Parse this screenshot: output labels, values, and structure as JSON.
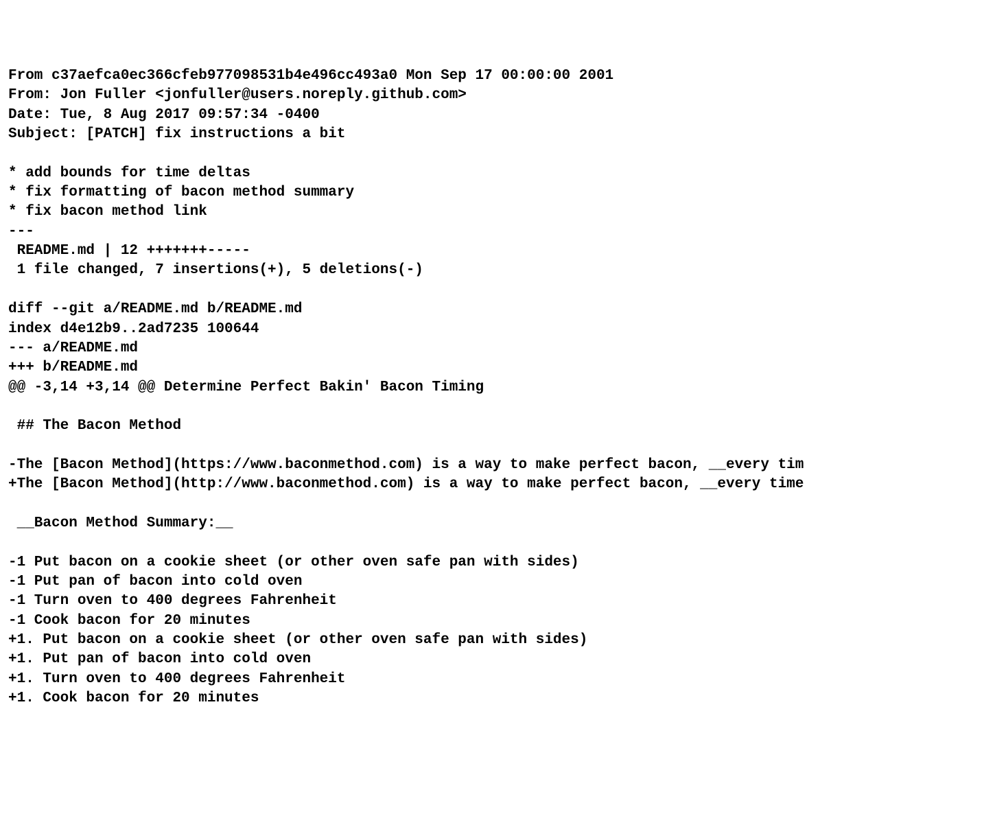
{
  "lines": [
    "From c37aefca0ec366cfeb977098531b4e496cc493a0 Mon Sep 17 00:00:00 2001",
    "From: Jon Fuller <jonfuller@users.noreply.github.com>",
    "Date: Tue, 8 Aug 2017 09:57:34 -0400",
    "Subject: [PATCH] fix instructions a bit",
    "",
    "* add bounds for time deltas",
    "* fix formatting of bacon method summary",
    "* fix bacon method link",
    "---",
    " README.md | 12 +++++++-----",
    " 1 file changed, 7 insertions(+), 5 deletions(-)",
    "",
    "diff --git a/README.md b/README.md",
    "index d4e12b9..2ad7235 100644",
    "--- a/README.md",
    "+++ b/README.md",
    "@@ -3,14 +3,14 @@ Determine Perfect Bakin' Bacon Timing",
    " ",
    " ## The Bacon Method",
    " ",
    "-The [Bacon Method](https://www.baconmethod.com) is a way to make perfect bacon, __every tim",
    "+The [Bacon Method](http://www.baconmethod.com) is a way to make perfect bacon, __every time",
    " ",
    " __Bacon Method Summary:__",
    " ",
    "-1 Put bacon on a cookie sheet (or other oven safe pan with sides)",
    "-1 Put pan of bacon into cold oven",
    "-1 Turn oven to 400 degrees Fahrenheit",
    "-1 Cook bacon for 20 minutes",
    "+1. Put bacon on a cookie sheet (or other oven safe pan with sides)",
    "+1. Put pan of bacon into cold oven",
    "+1. Turn oven to 400 degrees Fahrenheit",
    "+1. Cook bacon for 20 minutes"
  ]
}
